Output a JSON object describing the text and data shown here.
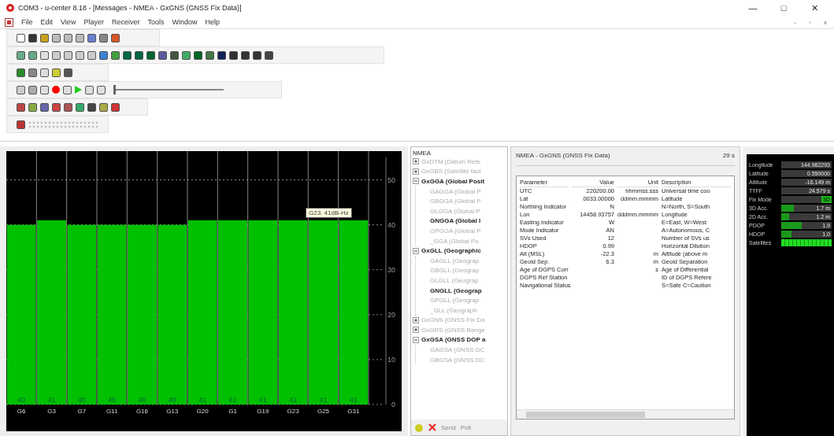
{
  "window": {
    "title": "COM3 - u-center 8.18 - [Messages - NMEA - GxGNS (GNSS Fix Data)]",
    "controls": [
      "—",
      "□",
      "✕"
    ],
    "child_controls": [
      "-",
      "▫",
      "x"
    ]
  },
  "menu": [
    "File",
    "Edit",
    "View",
    "Player",
    "Receiver",
    "Tools",
    "Window",
    "Help"
  ],
  "player": {
    "level": 0
  },
  "chart": {
    "tooltip": "G23: 41dB-Hz",
    "chart_data": {
      "type": "bar",
      "categories": [
        "G6",
        "G3",
        "G7",
        "G11",
        "G16",
        "G13",
        "G20",
        "G1",
        "G19",
        "G23",
        "G25",
        "G31"
      ],
      "series": [
        {
          "color": "#00c000",
          "values": [
            40,
            41,
            40,
            40,
            40,
            40,
            41,
            41,
            41,
            41,
            41,
            41
          ]
        }
      ],
      "ylim": [
        0,
        55
      ],
      "yticks": [
        0,
        10,
        20,
        30,
        40,
        50
      ],
      "grid": true,
      "value_labels": [
        "40",
        "41",
        "40",
        "45",
        "40",
        "40",
        "41",
        "41",
        "41",
        "41",
        "41",
        "41"
      ]
    }
  },
  "tree": {
    "root": "NMEA",
    "items": [
      {
        "label": "GxDTM (Datum Refe",
        "active": false,
        "expanded": false
      },
      {
        "label": "GxGBS (Satellite faul",
        "active": false,
        "expanded": false
      },
      {
        "label": "GxGGA (Global Posit",
        "active": true,
        "expanded": true,
        "children": [
          {
            "label": "GAGGA (Global P",
            "active": false
          },
          {
            "label": "GBGGA (Global P",
            "active": false
          },
          {
            "label": "GLGGA (Global P",
            "active": false
          },
          {
            "label": "GNGGA (Global I",
            "active": true
          },
          {
            "label": "GPGGA (Global P",
            "active": false
          },
          {
            "label": "_GGA (Global Po",
            "active": false
          }
        ]
      },
      {
        "label": "GxGLL (Geographic",
        "active": true,
        "expanded": true,
        "children": [
          {
            "label": "GAGLL (Geograp",
            "active": false
          },
          {
            "label": "GBGLL (Geograp",
            "active": false
          },
          {
            "label": "GLGLL (Geograp",
            "active": false
          },
          {
            "label": "GNGLL (Geograp",
            "active": true
          },
          {
            "label": "GPGLL (Geograp",
            "active": false
          },
          {
            "label": "_GLL (Geograph",
            "active": false
          }
        ]
      },
      {
        "label": "GxGNS (GNSS Fix Da",
        "active": false,
        "expanded": false
      },
      {
        "label": "GxGRS (GNSS Range",
        "active": false,
        "expanded": false
      },
      {
        "label": "GxGSA (GNSS DOP a",
        "active": true,
        "expanded": true,
        "children": [
          {
            "label": "GAGSA (GNSS DC",
            "active": false
          },
          {
            "label": "GBGSA (GNSS DC",
            "active": false
          }
        ]
      }
    ],
    "buttons": [
      {
        "label": "Send",
        "disabled": true
      },
      {
        "label": "Poll",
        "disabled": true
      }
    ]
  },
  "message": {
    "title": "NMEA - GxGNS (GNSS Fix Data)",
    "age": "29 s",
    "columns": [
      "Parameter",
      "Value",
      "Unit",
      "Description"
    ],
    "rows": [
      [
        "UTC",
        "220200.00",
        "hhmmss.sss",
        "Universal time coo"
      ],
      [
        "Lat",
        "0033.00000",
        "ddmm.mmmm",
        "Latitude"
      ],
      [
        "Northing Indicator",
        "N",
        "",
        "N=North, S=South"
      ],
      [
        "Lon",
        "14458.93757",
        "dddmm.mmmm",
        "Longitude"
      ],
      [
        "Easting Indicator",
        "W",
        "",
        "E=East, W=West"
      ],
      [
        "Mode Indicator",
        "AN",
        "",
        "A=Autonomous, C"
      ],
      [
        "SVs Used",
        "12",
        "",
        "Number of SVs us"
      ],
      [
        "HDOP",
        "0.99",
        "",
        "Horizontal Dilution"
      ],
      [
        "Alt (MSL)",
        "-22.3",
        "m",
        "Altitude (above m"
      ],
      [
        "Geoid Sep.",
        "6.3",
        "m",
        "Geoid Separation"
      ],
      [
        "Age of DGPS Corr",
        "",
        "s",
        "Age of Differential"
      ],
      [
        "DGPS Ref Station",
        "",
        "",
        "ID of DGPS Refere"
      ],
      [
        "Navigational Status",
        "",
        "",
        "S=Safe C=Caution"
      ]
    ]
  },
  "data_panel": [
    {
      "kind": "text",
      "label": "Longitude",
      "value": "144.982293"
    },
    {
      "kind": "text",
      "label": "Latitude",
      "value": "0.550000"
    },
    {
      "kind": "text",
      "label": "Altitude",
      "value": "-16.149 m"
    },
    {
      "kind": "text",
      "label": "TTFF",
      "value": "24.579 s"
    },
    {
      "kind": "fix",
      "label": "Fix Mode",
      "value": "3D"
    },
    {
      "kind": "bar",
      "label": "3D Acc.",
      "level": 0.25,
      "value": "1.7 m"
    },
    {
      "kind": "bar",
      "label": "2D Acc.",
      "level": 0.15,
      "value": "1.2 m"
    },
    {
      "kind": "bar",
      "label": "PDOP",
      "level": 0.4,
      "value": "1.9"
    },
    {
      "kind": "bar",
      "label": "HDOP",
      "level": 0.2,
      "value": "1.0"
    },
    {
      "kind": "sats",
      "label": "Satellites",
      "level": 1
    }
  ]
}
